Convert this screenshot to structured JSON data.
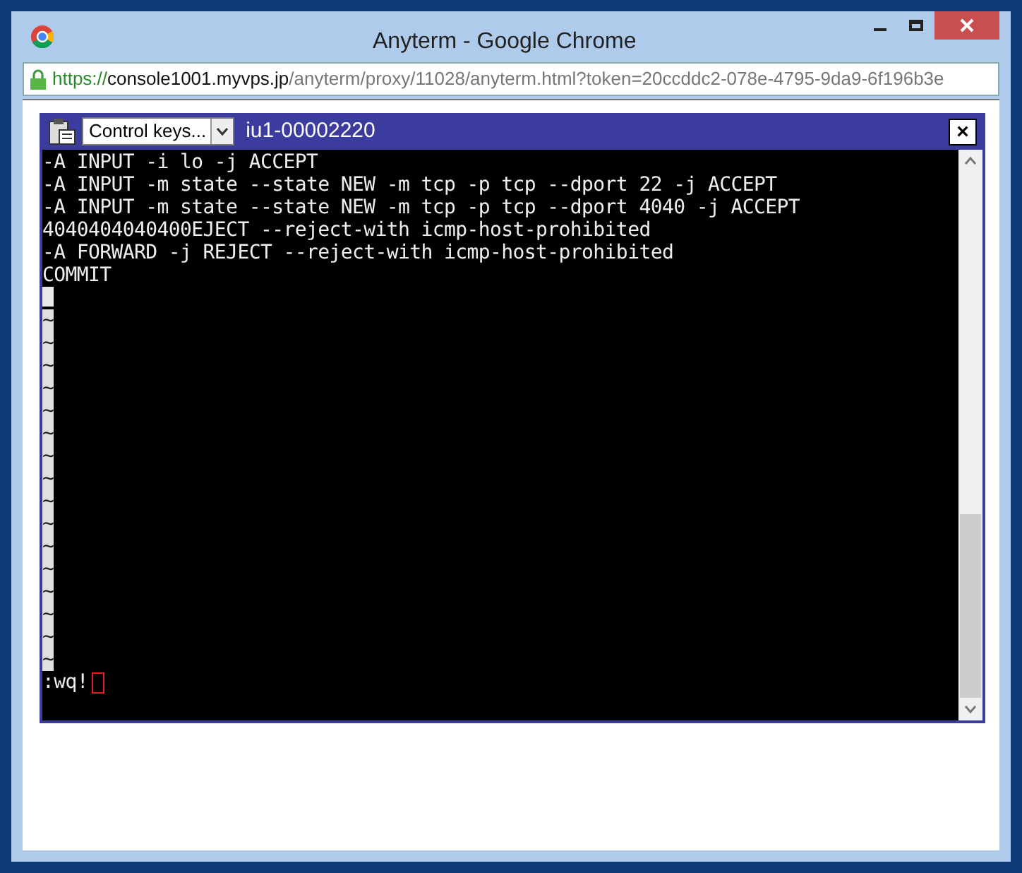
{
  "window": {
    "title": "Anyterm - Google Chrome"
  },
  "address_bar": {
    "scheme": "https://",
    "host": "console1001.myvps.jp",
    "path": "/anyterm/proxy/11028/anyterm.html?token=20ccddc2-078e-4795-9da9-6f196b3e"
  },
  "terminal": {
    "control_keys": "Control keys...",
    "session": "iu1-00002220",
    "close": "×",
    "lines": [
      {
        "kind": "text",
        "text": "-A INPUT -i lo -j ACCEPT"
      },
      {
        "kind": "text",
        "text": "-A INPUT -m state --state NEW -m tcp -p tcp --dport 22 -j ACCEPT"
      },
      {
        "kind": "text",
        "text": "-A INPUT -m state --state NEW -m tcp -p tcp --dport 4040 -j ACCEPT"
      },
      {
        "kind": "text",
        "text": "4040404040400EJECT --reject-with icmp-host-prohibited"
      },
      {
        "kind": "text",
        "text": "-A FORWARD -j REJECT --reject-with icmp-host-prohibited"
      },
      {
        "kind": "text",
        "text": "COMMIT"
      },
      {
        "kind": "cursor"
      },
      {
        "kind": "tilde",
        "text": "~"
      },
      {
        "kind": "tilde",
        "text": "~"
      },
      {
        "kind": "tilde",
        "text": "~"
      },
      {
        "kind": "tilde",
        "text": "~"
      },
      {
        "kind": "tilde",
        "text": "~"
      },
      {
        "kind": "tilde",
        "text": "~"
      },
      {
        "kind": "tilde",
        "text": "~"
      },
      {
        "kind": "tilde",
        "text": "~"
      },
      {
        "kind": "tilde",
        "text": "~"
      },
      {
        "kind": "tilde",
        "text": "~"
      },
      {
        "kind": "tilde",
        "text": "~"
      },
      {
        "kind": "tilde",
        "text": "~"
      },
      {
        "kind": "tilde",
        "text": "~"
      },
      {
        "kind": "tilde",
        "text": "~"
      },
      {
        "kind": "tilde",
        "text": "~"
      },
      {
        "kind": "tilde",
        "text": "~"
      },
      {
        "kind": "command",
        "text": ":wq!"
      }
    ]
  }
}
